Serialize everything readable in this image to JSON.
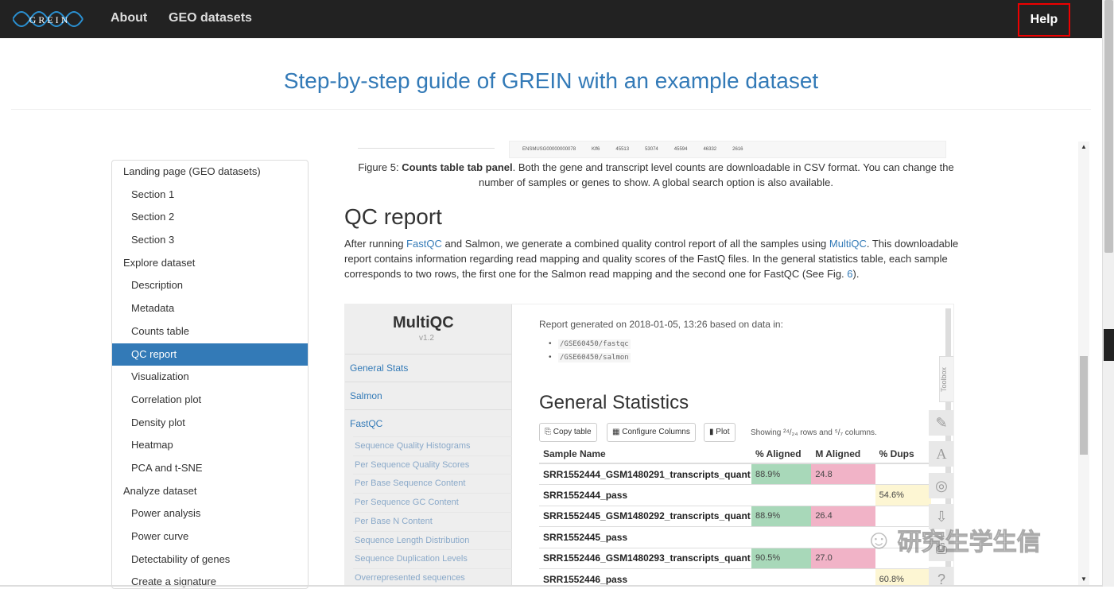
{
  "nav": {
    "logo_text": "G R E I N",
    "links": [
      "About",
      "GEO datasets"
    ],
    "help": "Help"
  },
  "page_title": "Step-by-step guide of GREIN with an example dataset",
  "sidebar": [
    {
      "label": "Landing page (GEO datasets)",
      "level": 1
    },
    {
      "label": "Section 1",
      "level": 2
    },
    {
      "label": "Section 2",
      "level": 2
    },
    {
      "label": "Section 3",
      "level": 2
    },
    {
      "label": "Explore dataset",
      "level": 1
    },
    {
      "label": "Description",
      "level": 2
    },
    {
      "label": "Metadata",
      "level": 2
    },
    {
      "label": "Counts table",
      "level": 2
    },
    {
      "label": "QC report",
      "level": 2,
      "active": true
    },
    {
      "label": "Visualization",
      "level": 2
    },
    {
      "label": "Correlation plot",
      "level": 2
    },
    {
      "label": "Density plot",
      "level": 2
    },
    {
      "label": "Heatmap",
      "level": 2
    },
    {
      "label": "PCA and t-SNE",
      "level": 2
    },
    {
      "label": "Analyze dataset",
      "level": 1
    },
    {
      "label": "Power analysis",
      "level": 2
    },
    {
      "label": "Power curve",
      "level": 2
    },
    {
      "label": "Detectability of genes",
      "level": 2
    },
    {
      "label": "Create a signature",
      "level": 2
    }
  ],
  "fig5_row": [
    "ENSMUSG00000000078",
    "Klf6",
    "45513",
    "53074",
    "45594",
    "46332",
    "2616"
  ],
  "fig5_caption": {
    "prefix": "Figure 5: ",
    "bold": "Counts table tab panel",
    "rest": ". Both the gene and transcript level counts are downloadable in CSV format. You can change the number of samples or genes to show. A global search option is also available."
  },
  "qc": {
    "heading": "QC report",
    "p1": "After running ",
    "fastqc": "FastQC",
    "p2": " and Salmon, we generate a combined quality control report of all the samples using ",
    "multiqc": "MultiQC",
    "p3": ". This downloadable report contains information regarding read mapping and quality scores of the FastQ files. In the general statistics table, each sample corresponds to two rows, the first one for the Salmon read mapping and the second one for FastQC (See Fig. ",
    "fig": "6",
    "p4": ")."
  },
  "multiqc": {
    "logo": "MultiQC",
    "version": "v1.2",
    "nav": [
      "General Stats",
      "Salmon",
      "FastQC"
    ],
    "sub": [
      "Sequence Quality Histograms",
      "Per Sequence Quality Scores",
      "Per Base Sequence Content",
      "Per Sequence GC Content",
      "Per Base N Content",
      "Sequence Length Distribution",
      "Sequence Duplication Levels",
      "Overrepresented sequences"
    ],
    "report_generated": "Report generated on 2018-01-05, 13:26 based on data in:",
    "dirs": [
      "/GSE60450/fastqc",
      "/GSE60450/salmon"
    ],
    "gs_title": "General Statistics",
    "buttons": [
      "Copy table",
      "Configure Columns",
      "Plot"
    ],
    "showing": "Showing ²⁴/₂₄ rows and ⁵/₇ columns.",
    "headers": [
      "Sample Name",
      "% Aligned",
      "M Aligned",
      "% Dups"
    ],
    "rows": [
      [
        "SRR1552444_GSM1480291_transcripts_quant",
        "88.9%",
        "24.8",
        ""
      ],
      [
        "SRR1552444_pass",
        "",
        "",
        "54.6%"
      ],
      [
        "SRR1552445_GSM1480292_transcripts_quant",
        "88.9%",
        "26.4",
        ""
      ],
      [
        "SRR1552445_pass",
        "",
        "",
        ""
      ],
      [
        "SRR1552446_GSM1480293_transcripts_quant",
        "90.5%",
        "27.0",
        ""
      ],
      [
        "SRR1552446_pass",
        "",
        "",
        "60.8%"
      ]
    ],
    "toolbox": "Toolbox"
  },
  "watermark": "研究生学生信"
}
